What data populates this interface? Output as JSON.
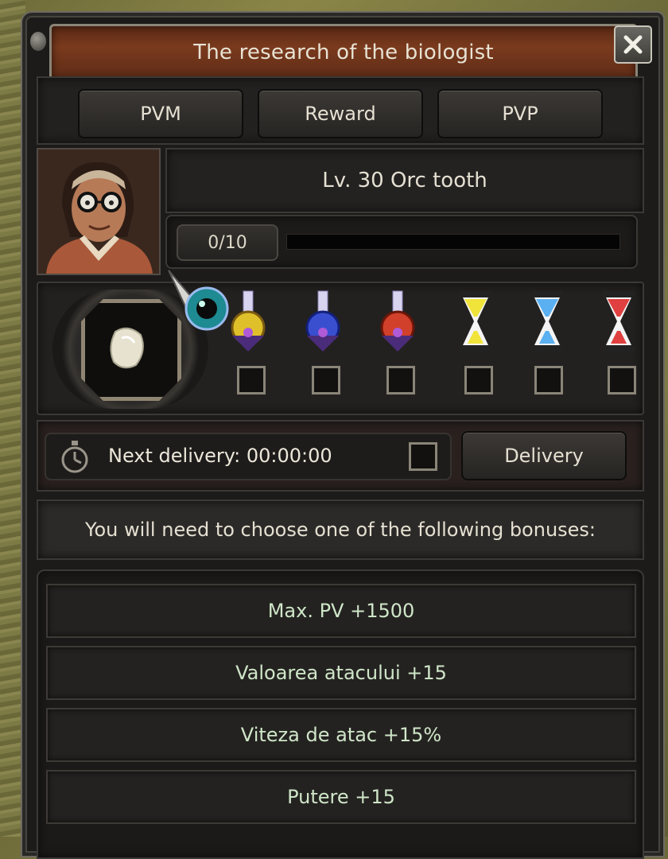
{
  "window": {
    "title": "The research of the biologist"
  },
  "tabs": [
    {
      "label": "PVM"
    },
    {
      "label": "Reward"
    },
    {
      "label": "PVP"
    }
  ],
  "quest": {
    "title": "Lv. 30 Orc tooth",
    "progress_label": "0/10",
    "progress_fraction": 0
  },
  "reward_item": {
    "icon": "orc-tooth-icon"
  },
  "boosters": [
    {
      "icon": "yellow-potion-icon",
      "color": "#e0c02a",
      "checked": false
    },
    {
      "icon": "blue-potion-icon",
      "color": "#3a4fd0",
      "checked": false
    },
    {
      "icon": "red-potion-icon",
      "color": "#d0402a",
      "checked": false
    },
    {
      "icon": "yellow-hourglass-icon",
      "color": "#f0e43a",
      "checked": false
    },
    {
      "icon": "blue-hourglass-icon",
      "color": "#5ab0f0",
      "checked": false
    },
    {
      "icon": "red-hourglass-icon",
      "color": "#e04040",
      "checked": false
    }
  ],
  "delivery": {
    "timer_text": "Next delivery: 00:00:00",
    "button_label": "Delivery"
  },
  "bonus_header": "You will need to choose one of the following bonuses:",
  "bonuses": [
    {
      "label": "Max. PV +1500"
    },
    {
      "label": "Valoarea atacului +15"
    },
    {
      "label": "Viteza de atac +15%"
    },
    {
      "label": "Putere +15"
    }
  ]
}
